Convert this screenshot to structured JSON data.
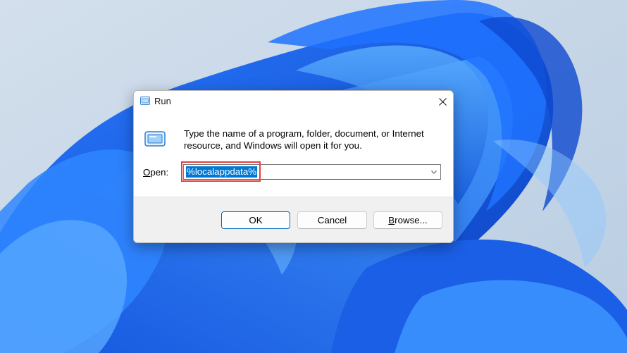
{
  "dialog": {
    "title": "Run",
    "close_icon": "close-icon",
    "description": "Type the name of a program, folder, document, or Internet resource, and Windows will open it for you.",
    "open_label_accel": "O",
    "open_label_rest": "pen:",
    "open_value": "%localappdata%",
    "buttons": {
      "ok": "OK",
      "cancel": "Cancel",
      "browse_accel": "B",
      "browse_rest": "rowse..."
    }
  },
  "colors": {
    "selection": "#0078d4",
    "highlight_box": "#e0413f",
    "accent": "#0067c0",
    "wallpaper_blue": "#1b6cf0"
  }
}
